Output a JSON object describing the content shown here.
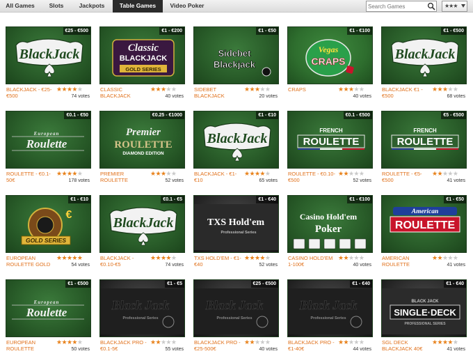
{
  "nav": {
    "tabs": [
      {
        "label": "All Games",
        "active": false
      },
      {
        "label": "Slots",
        "active": false
      },
      {
        "label": "Jackpots",
        "active": false
      },
      {
        "label": "Table Games",
        "active": true
      },
      {
        "label": "Video Poker",
        "active": false
      }
    ],
    "search_placeholder": "Search Games",
    "search_icon": "magnifier-icon",
    "rating_filter_value": "★★★",
    "colors": {
      "active_tab_bg": "#2b2b2b",
      "accent_orange": "#e0701a",
      "felt_green": "#2a5e2a"
    }
  },
  "games": [
    {
      "name": "BLACKJACK - €25-€500",
      "range": "€25 - €500",
      "rating": 4,
      "votes": "74 votes",
      "logo_lines": [
        "BlackJack"
      ]
    },
    {
      "name": "CLASSIC BLACKJACK",
      "range": "€1 - €200",
      "rating": 3,
      "votes": "40 votes",
      "logo_lines": [
        "Classic",
        "BLACKJACK",
        "GOLD SERIES"
      ]
    },
    {
      "name": "SIDEBET BLACKJACK",
      "range": "€1 - €50",
      "rating": 3,
      "votes": "20 votes",
      "logo_lines": [
        "Sidebet",
        "Blackjack"
      ]
    },
    {
      "name": "CRAPS",
      "range": "€1 - €100",
      "rating": 3,
      "votes": "40 votes",
      "logo_lines": [
        "Vegas",
        "CRAPS"
      ]
    },
    {
      "name": "BLACKJACK €1 - €500",
      "range": "€1 - €500",
      "rating": 3,
      "votes": "68 votes",
      "logo_lines": [
        "BlackJack"
      ]
    },
    {
      "name": "ROULETTE - €0.1-50€",
      "range": "€0.1 - €50",
      "rating": 4,
      "votes": "178 votes",
      "logo_lines": [
        "European",
        "Roulette"
      ]
    },
    {
      "name": "PREMIER ROULETTE",
      "range": "€0.25 - €1000",
      "rating": 3,
      "votes": "52 votes",
      "logo_lines": [
        "Premier",
        "ROULETTE",
        "DIAMOND EDITION"
      ]
    },
    {
      "name": "BLACKJACK - €1-€10",
      "range": "€1 - €10",
      "rating": 4,
      "votes": "65 votes",
      "logo_lines": [
        "BlackJack"
      ]
    },
    {
      "name": "ROULETTE - €0.10-€500",
      "range": "€0.1 - €500",
      "rating": 2,
      "votes": "52 votes",
      "logo_lines": [
        "FRENCH",
        "ROULETTE"
      ]
    },
    {
      "name": "ROULETTE - €5-€500",
      "range": "€5 - €500",
      "rating": 2,
      "votes": "41 votes",
      "logo_lines": [
        "FRENCH",
        "ROULETTE"
      ]
    },
    {
      "name": "EUROPEAN ROULETTE GOLD",
      "range": "€1 - €10",
      "rating": 5,
      "votes": "54 votes",
      "logo_lines": [
        "€",
        "GOLD SERIES"
      ]
    },
    {
      "name": "BLACKJACK - €0.10-€5",
      "range": "€0.1 - €5",
      "rating": 4,
      "votes": "74 votes",
      "logo_lines": [
        "BlackJack"
      ]
    },
    {
      "name": "TXS HOLD'EM - €1-€40",
      "range": "€1 - €40",
      "rating": 4,
      "votes": "52 votes",
      "logo_lines": [
        "TXS Hold'em",
        "Professional Series"
      ]
    },
    {
      "name": "CASINO HOLD'EM 1-100€",
      "range": "€1 - €100",
      "rating": 2,
      "votes": "40 votes",
      "logo_lines": [
        "Casino Hold'em",
        "Poker"
      ]
    },
    {
      "name": "AMERICAN ROULETTE",
      "range": "€1 - €50",
      "rating": 2,
      "votes": "41 votes",
      "logo_lines": [
        "American",
        "ROULETTE"
      ]
    },
    {
      "name": "EUROPEAN ROULETTE",
      "range": "€1 - €500",
      "rating": 4,
      "votes": "50 votes",
      "logo_lines": [
        "European",
        "Roulette"
      ]
    },
    {
      "name": "BLACKJACK PRO - €0.1-5€",
      "range": "€1 - €5",
      "rating": 2,
      "votes": "55 votes",
      "logo_lines": [
        "Black Jack",
        "Professional Series"
      ]
    },
    {
      "name": "BLACKJACK PRO - €25-500€",
      "range": "€25 - €500",
      "rating": 2,
      "votes": "40 votes",
      "logo_lines": [
        "Black Jack",
        "Professional Series"
      ]
    },
    {
      "name": "BLACKJACK PRO - €1-40€",
      "range": "€1 - €40",
      "rating": 2,
      "votes": "44 votes",
      "logo_lines": [
        "Black Jack",
        "Professional Series"
      ]
    },
    {
      "name": "SGL DECK BLACKJACK 40€",
      "range": "€1 - €40",
      "rating": 4,
      "votes": "41 votes",
      "logo_lines": [
        "BLACK JACK",
        "SINGLE·DECK",
        "PROFESSIONAL SERIES"
      ]
    }
  ]
}
